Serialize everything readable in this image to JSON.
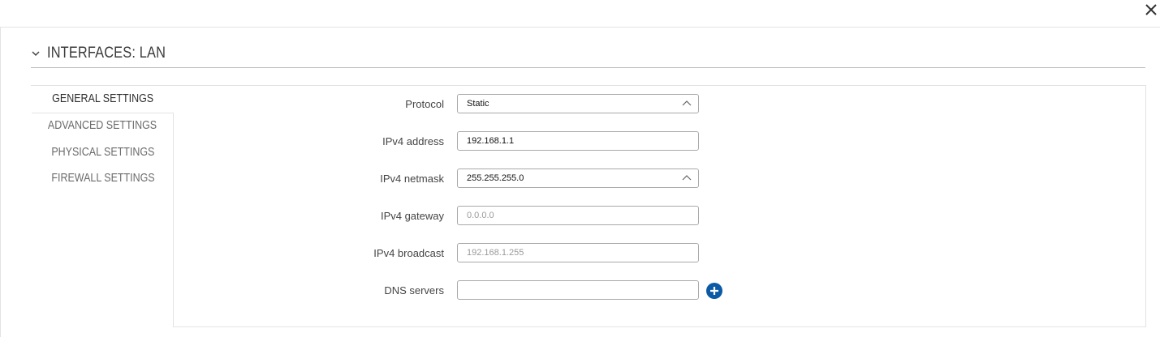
{
  "dialog": {
    "close_icon": "close-icon"
  },
  "section": {
    "title": "INTERFACES: LAN",
    "toggle_icon": "chevron-down-icon"
  },
  "tabs": [
    {
      "label": "GENERAL SETTINGS",
      "active": true
    },
    {
      "label": "ADVANCED SETTINGS",
      "active": false
    },
    {
      "label": "PHYSICAL SETTINGS",
      "active": false
    },
    {
      "label": "FIREWALL SETTINGS",
      "active": false
    }
  ],
  "form": {
    "protocol": {
      "label": "Protocol",
      "value": "Static",
      "type": "select"
    },
    "ipv4_address": {
      "label": "IPv4 address",
      "value": "192.168.1.1",
      "type": "input"
    },
    "ipv4_netmask": {
      "label": "IPv4 netmask",
      "value": "255.255.255.0",
      "type": "select"
    },
    "ipv4_gateway": {
      "label": "IPv4 gateway",
      "value": "",
      "placeholder": "0.0.0.0",
      "type": "input"
    },
    "ipv4_broadcast": {
      "label": "IPv4 broadcast",
      "value": "",
      "placeholder": "192.168.1.255",
      "type": "input"
    },
    "dns_servers": {
      "label": "DNS servers",
      "value": "",
      "placeholder": "",
      "type": "input",
      "add_icon": "plus-circle-icon"
    }
  },
  "colors": {
    "accent": "#0b5aa5",
    "border": "#a9a9a9"
  }
}
